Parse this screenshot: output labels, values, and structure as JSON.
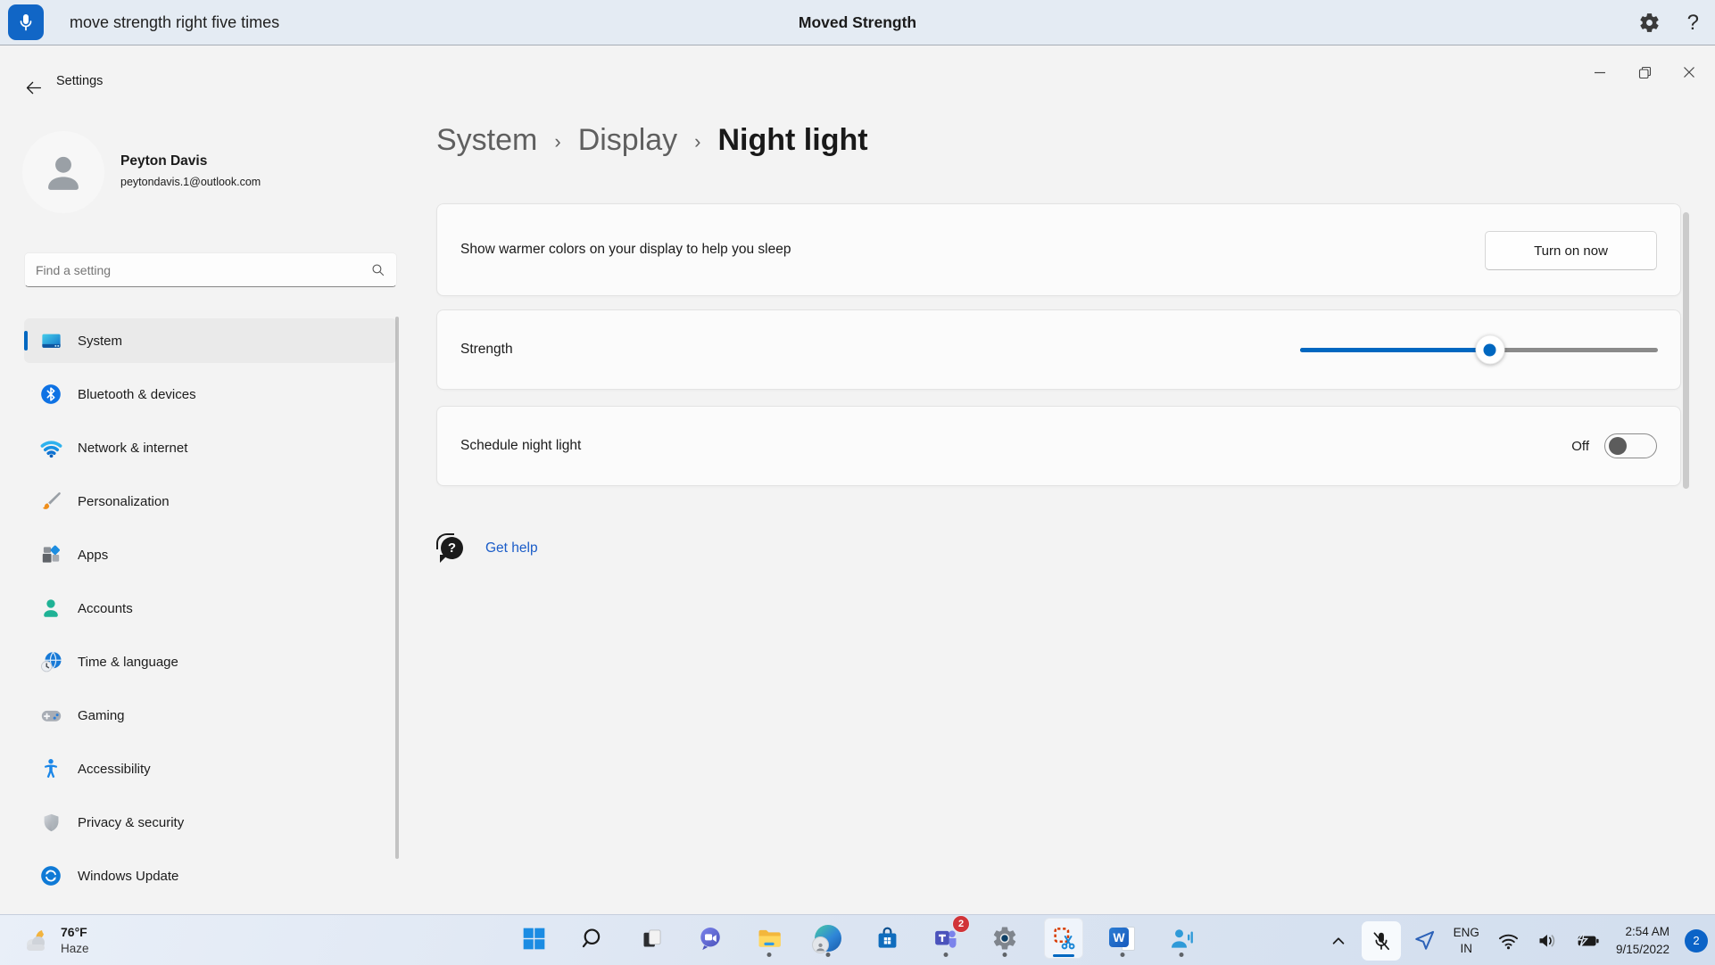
{
  "assistant_bar": {
    "command": "move strength right five times",
    "title": "Moved Strength",
    "help_glyph": "?"
  },
  "settings_window": {
    "title": "Settings"
  },
  "profile": {
    "name": "Peyton Davis",
    "email": "peytondavis.1@outlook.com"
  },
  "search": {
    "placeholder": "Find a setting"
  },
  "sidebar": {
    "items": [
      {
        "label": "System",
        "icon": "system",
        "selected": true
      },
      {
        "label": "Bluetooth & devices",
        "icon": "bluetooth"
      },
      {
        "label": "Network & internet",
        "icon": "network"
      },
      {
        "label": "Personalization",
        "icon": "personalization"
      },
      {
        "label": "Apps",
        "icon": "apps"
      },
      {
        "label": "Accounts",
        "icon": "accounts"
      },
      {
        "label": "Time & language",
        "icon": "time-language"
      },
      {
        "label": "Gaming",
        "icon": "gaming"
      },
      {
        "label": "Accessibility",
        "icon": "accessibility"
      },
      {
        "label": "Privacy & security",
        "icon": "privacy-security"
      },
      {
        "label": "Windows Update",
        "icon": "windows-update"
      }
    ]
  },
  "breadcrumb": {
    "root": "System",
    "section": "Display",
    "page": "Night light",
    "separator": "›"
  },
  "night_light": {
    "warmth": {
      "description": "Show warmer colors on your display to help you sleep",
      "button_label": "Turn on now"
    },
    "strength": {
      "label": "Strength",
      "value_percent": 53
    },
    "schedule": {
      "label": "Schedule night light",
      "toggle_state": "Off"
    },
    "help_link": "Get help",
    "help_glyph": "?"
  },
  "taskbar": {
    "weather": {
      "temperature": "76°F",
      "condition": "Haze"
    },
    "apps": [
      {
        "name": "start"
      },
      {
        "name": "search"
      },
      {
        "name": "task-view"
      },
      {
        "name": "teams-chat"
      },
      {
        "name": "file-explorer",
        "running": true
      },
      {
        "name": "edge",
        "running": true
      },
      {
        "name": "microsoft-store"
      },
      {
        "name": "teams",
        "running": true,
        "badge": "2"
      },
      {
        "name": "settings",
        "running": true
      },
      {
        "name": "snipping-tool",
        "active": true
      },
      {
        "name": "word",
        "running": true,
        "glyph": "W"
      },
      {
        "name": "voice-access",
        "running": true
      }
    ],
    "tray": {
      "language_line1": "ENG",
      "language_line2": "IN",
      "time": "2:54 AM",
      "date": "9/15/2022",
      "notification_count": "2"
    }
  },
  "colors": {
    "accent": "#0067c0",
    "assistant_bar_bg": "#e4ebf3",
    "taskbar_bg": "#dde6f2",
    "badge_red": "#d13438"
  }
}
